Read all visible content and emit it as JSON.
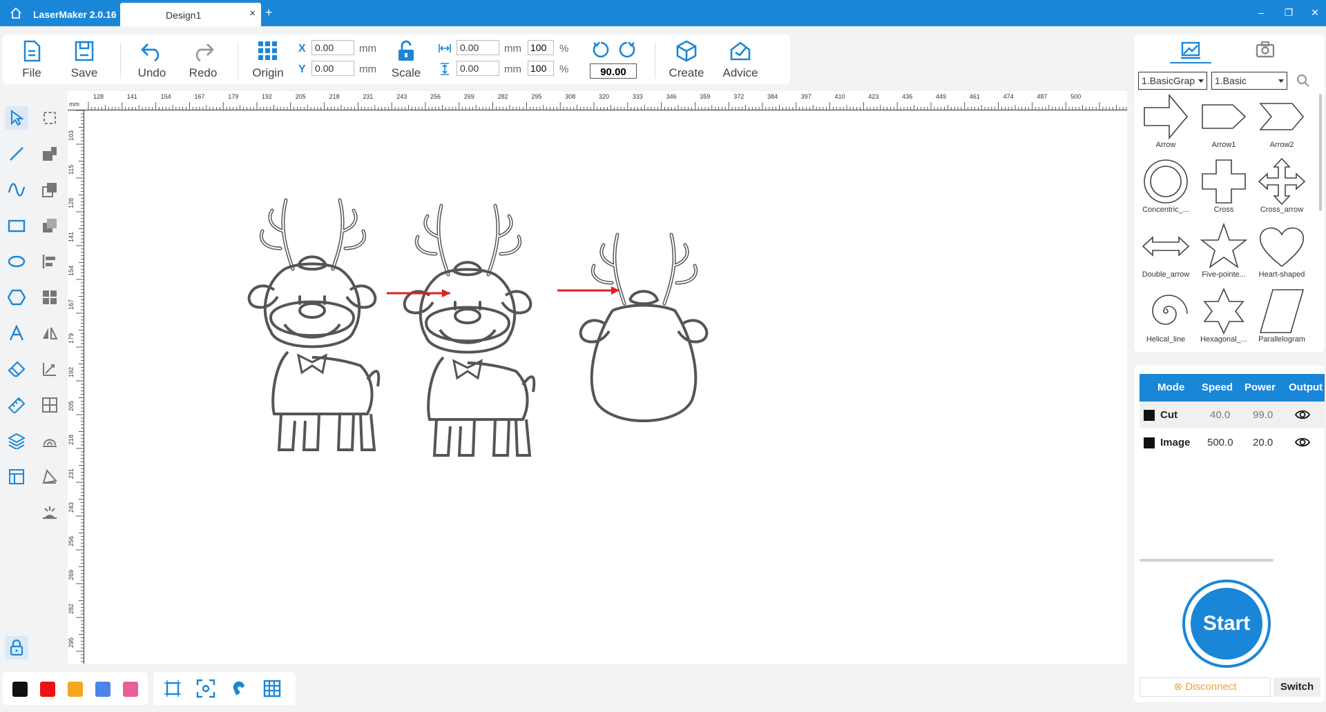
{
  "titlebar": {
    "app_name": "LaserMaker 2.0.16",
    "tab_label": "Design1",
    "tab_close": "×",
    "tab_add": "+",
    "minimize": "–",
    "maximize": "❐",
    "close": "✕"
  },
  "toolbar": {
    "file": "File",
    "save": "Save",
    "undo": "Undo",
    "redo": "Redo",
    "origin": "Origin",
    "scale": "Scale",
    "create": "Create",
    "advice": "Advice",
    "x_label": "X",
    "y_label": "Y",
    "x_value": "0.00",
    "y_value": "0.00",
    "width_value": "0.00",
    "height_value": "0.00",
    "width_pct": "100",
    "height_pct": "100",
    "unit_mm": "mm",
    "unit_pct": "%",
    "rotate_angle": "90.00"
  },
  "ruler": {
    "unit": "mm",
    "top_ticks": [
      "128",
      "141",
      "154",
      "167",
      "179",
      "192",
      "205",
      "218",
      "231",
      "243",
      "256",
      "269",
      "282",
      "295",
      "308",
      "320",
      "333",
      "346",
      "359",
      "372",
      "384",
      "397",
      "410",
      "423",
      "436",
      "449",
      "461",
      "474",
      "487",
      "500"
    ],
    "left_ticks": [
      "103",
      "115",
      "128",
      "141",
      "154",
      "167",
      "179",
      "192",
      "205",
      "218",
      "231",
      "243",
      "256",
      "269",
      "282",
      "295"
    ]
  },
  "colors": {
    "accent": "#1a86d8",
    "swatches": [
      "#111111",
      "#ee1111",
      "#f5a623",
      "#4a86e8",
      "#e8609a"
    ]
  },
  "library": {
    "category": "1.BasicGrap",
    "subcategory": "1.Basic",
    "shapes": [
      "Arrow",
      "Arrow1",
      "Arrow2",
      "Concentric_...",
      "Cross",
      "Cross_arrow",
      "Double_arrow",
      "Five-pointe...",
      "Heart-shaped",
      "Helical_line",
      "Hexagonal_...",
      "Parallelogram"
    ]
  },
  "layers": {
    "headers": [
      "Mode",
      "Speed",
      "Power",
      "Output"
    ],
    "rows": [
      {
        "mode": "Cut",
        "speed": "40.0",
        "power": "99.0"
      },
      {
        "mode": "Image",
        "speed": "500.0",
        "power": "20.0"
      }
    ]
  },
  "actions": {
    "start": "Start",
    "disconnect": "Disconnect",
    "switch": "Switch"
  }
}
